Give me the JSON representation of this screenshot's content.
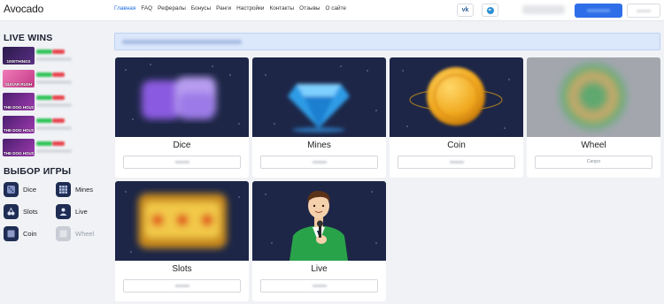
{
  "header": {
    "logo": "Avocado",
    "nav": [
      {
        "label": "Главная",
        "active": true
      },
      {
        "label": "FAQ"
      },
      {
        "label": "Рефералы"
      },
      {
        "label": "Бонусы"
      },
      {
        "label": "Ранги"
      },
      {
        "label": "Настройки"
      },
      {
        "label": "Контакты"
      },
      {
        "label": "Отзывы"
      },
      {
        "label": "О сайте"
      }
    ],
    "social": {
      "vk": "vk",
      "telegram_icon": "telegram-icon"
    }
  },
  "sidebar": {
    "live_wins_title": "LIVE WINS",
    "wins": [
      {
        "game": "1000THINGS",
        "thumb_color": "#3a1f5c"
      },
      {
        "game": "SUGAR RUSH",
        "thumb_color": "#d45fa0"
      },
      {
        "game": "THE DOG HOUSE",
        "thumb_color": "#7a2a8a"
      },
      {
        "game": "THE DOG HOUSE",
        "thumb_color": "#7a2a8a"
      },
      {
        "game": "THE DOG HOUSE",
        "thumb_color": "#7a2a8a"
      }
    ],
    "game_select_title": "ВЫБОР ИГРЫ",
    "games": [
      {
        "label": "Dice",
        "icon": "dice-icon",
        "disabled": false
      },
      {
        "label": "Mines",
        "icon": "grid-icon",
        "disabled": false
      },
      {
        "label": "Slots",
        "icon": "cherry-icon",
        "disabled": false
      },
      {
        "label": "Live",
        "icon": "person-icon",
        "disabled": false
      },
      {
        "label": "Coin",
        "icon": "coin-icon",
        "disabled": false
      },
      {
        "label": "Wheel",
        "icon": "wheel-icon",
        "disabled": true
      }
    ]
  },
  "cards": [
    {
      "title": "Dice",
      "button": ""
    },
    {
      "title": "Mines",
      "button": ""
    },
    {
      "title": "Coin",
      "button": ""
    },
    {
      "title": "Wheel",
      "button": "Скоро"
    },
    {
      "title": "Slots",
      "button": ""
    },
    {
      "title": "Live",
      "button": ""
    }
  ],
  "colors": {
    "accent": "#1e6fe0",
    "primary_button": "#2e6ee8",
    "card_bg": "#1d2647"
  }
}
